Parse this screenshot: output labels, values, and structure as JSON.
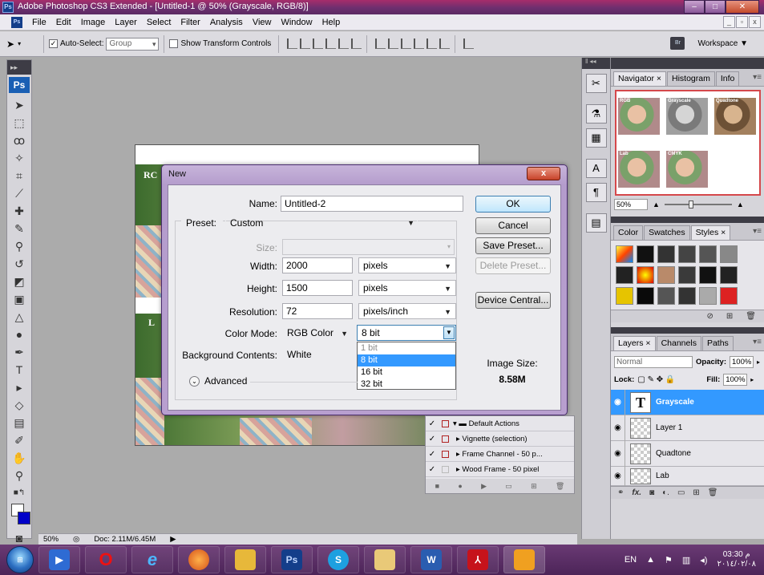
{
  "window": {
    "title": "Adobe Photoshop CS3 Extended - [Untitled-1 @ 50% (Grayscale, RGB/8)]",
    "app_badge": "Ps"
  },
  "menu": [
    "File",
    "Edit",
    "Image",
    "Layer",
    "Select",
    "Filter",
    "Analysis",
    "View",
    "Window",
    "Help"
  ],
  "options_bar": {
    "auto_select_label": "Auto-Select:",
    "auto_select_value": "Group",
    "show_transform_label": "Show Transform Controls",
    "workspace_label": "Workspace ▼",
    "bridge_badge": "Br"
  },
  "toolbox": {
    "logo": "Ps"
  },
  "document": {
    "tag1": "RC",
    "tag2": "L"
  },
  "dialog": {
    "title": "New",
    "close_label": "x",
    "name_label": "Name:",
    "name_value": "Untitled-2",
    "preset_label": "Preset:",
    "preset_value": "Custom",
    "size_label": "Size:",
    "width_label": "Width:",
    "width_value": "2000",
    "width_unit": "pixels",
    "height_label": "Height:",
    "height_value": "1500",
    "height_unit": "pixels",
    "resolution_label": "Resolution:",
    "resolution_value": "72",
    "resolution_unit": "pixels/inch",
    "color_mode_label": "Color Mode:",
    "color_mode_value": "RGB Color",
    "bit_depth_value": "8 bit",
    "bit_depth_options": [
      "1 bit",
      "8 bit",
      "16 bit",
      "32 bit"
    ],
    "bg_contents_label": "Background Contents:",
    "bg_contents_value": "White",
    "advanced_label": "Advanced",
    "image_size_label": "Image Size:",
    "image_size_value": "8.58M",
    "buttons": {
      "ok": "OK",
      "cancel": "Cancel",
      "save_preset": "Save Preset...",
      "delete_preset": "Delete Preset...",
      "device_central": "Device Central..."
    }
  },
  "navigator": {
    "tabs": [
      "Navigator ×",
      "Histogram",
      "Info"
    ],
    "zoom": "50%",
    "thumb_labels": [
      "RGB",
      "Grayscale",
      "Quadtone",
      "Lab",
      "CMYK"
    ]
  },
  "styles": {
    "tabs": [
      "Color",
      "Swatches",
      "Styles ×"
    ]
  },
  "layers": {
    "tabs": [
      "Layers ×",
      "Channels",
      "Paths"
    ],
    "blend_mode": "Normal",
    "opacity_label": "Opacity:",
    "opacity_value": "100%",
    "lock_label": "Lock:",
    "fill_label": "Fill:",
    "fill_value": "100%",
    "items": [
      {
        "name": "Grayscale",
        "thumb": "T"
      },
      {
        "name": "Layer 1"
      },
      {
        "name": "Quadtone"
      },
      {
        "name": "Lab"
      }
    ]
  },
  "actions": {
    "items": [
      "Default Actions",
      "Vignette (selection)",
      "Frame Channel - 50 p...",
      "Wood Frame - 50 pixel"
    ]
  },
  "statusbar": {
    "zoom": "50%",
    "doc": "Doc: 2.11M/6.45M"
  },
  "taskbar": {
    "apps": [
      "Ps",
      "S",
      "W"
    ],
    "lang": "EN",
    "time": "03:30 م",
    "date": "٢٠١٤/٠٢/٠٨"
  },
  "colors": {
    "titlebar": "#6d2f6f",
    "selection": "#3399ff",
    "dialog_frame": "#b89fcf"
  }
}
